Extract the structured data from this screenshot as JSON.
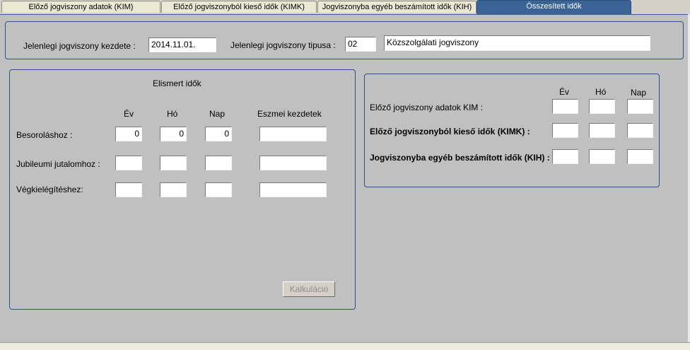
{
  "tabs": [
    {
      "label": "Előző jogviszony adatok (KIM)"
    },
    {
      "label": "Előző jogviszonyból kieső idők (KIMK)"
    },
    {
      "label": "Jogviszonyba egyéb beszámított idők (KIH)"
    },
    {
      "label": "Összesített idők"
    }
  ],
  "header": {
    "start_label": "Jelenlegi jogviszony kezdete :",
    "start_value": "2014.11.01.",
    "type_label": "Jelenlegi jogviszony tipusa :",
    "type_code": "02",
    "type_name": "Közszolgálati jogviszony"
  },
  "recognized": {
    "title": "Elismert idők",
    "col_year": "Év",
    "col_month": "Hó",
    "col_day": "Nap",
    "col_notional": "Eszmei kezdetek",
    "rows": [
      {
        "label": "Besoroláshoz :",
        "year": "0",
        "month": "0",
        "day": "0",
        "notional": ""
      },
      {
        "label": "Jubileumi jutalomhoz :",
        "year": "",
        "month": "",
        "day": "",
        "notional": ""
      },
      {
        "label": "Végkielégítéshez:",
        "year": "",
        "month": "",
        "day": "",
        "notional": ""
      }
    ],
    "calc_button": "Kalkuláció"
  },
  "previous": {
    "col_year": "Év",
    "col_month": "Hó",
    "col_day": "Nap",
    "rows": [
      {
        "label": "Előző jogviszony adatok KIM :",
        "year": "",
        "month": "",
        "day": ""
      },
      {
        "label": "Előző jogviszonyból kieső idők (KIMK) :",
        "year": "",
        "month": "",
        "day": ""
      },
      {
        "label": "Jogviszonyba egyéb beszámított idők (KIH) :",
        "year": "",
        "month": "",
        "day": ""
      }
    ]
  }
}
